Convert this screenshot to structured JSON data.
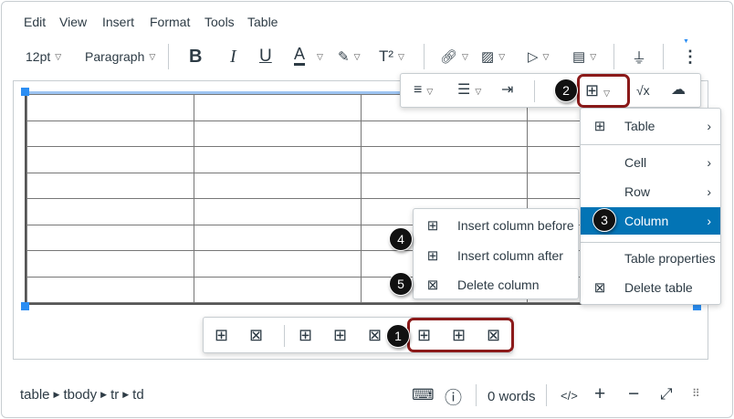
{
  "menubar": [
    "Edit",
    "View",
    "Insert",
    "Format",
    "Tools",
    "Table"
  ],
  "toolbar": {
    "font_size": "12pt",
    "block_format": "Paragraph",
    "bold": "B",
    "italic": "I",
    "underline": "U",
    "text_color": "A",
    "superscript": "T²"
  },
  "table_menu": {
    "items": [
      {
        "label": "Table",
        "icon": "table-icon",
        "submenu": true
      },
      {
        "label": "Cell",
        "submenu": true
      },
      {
        "label": "Row",
        "submenu": true
      },
      {
        "label": "Column",
        "submenu": true,
        "active": true
      },
      {
        "label": "Table properties"
      },
      {
        "label": "Delete table",
        "icon": "delete-table-icon"
      }
    ]
  },
  "column_menu": {
    "items": [
      {
        "label": "Insert column before"
      },
      {
        "label": "Insert column after"
      },
      {
        "label": "Delete column"
      }
    ]
  },
  "callouts": [
    "1",
    "2",
    "3",
    "4",
    "5"
  ],
  "status": {
    "path": [
      "table",
      "tbody",
      "tr",
      "td"
    ],
    "words": "0 words",
    "html": "</>"
  },
  "colors": {
    "accent": "#0374b5",
    "callout_outline": "#8b1a1a"
  }
}
